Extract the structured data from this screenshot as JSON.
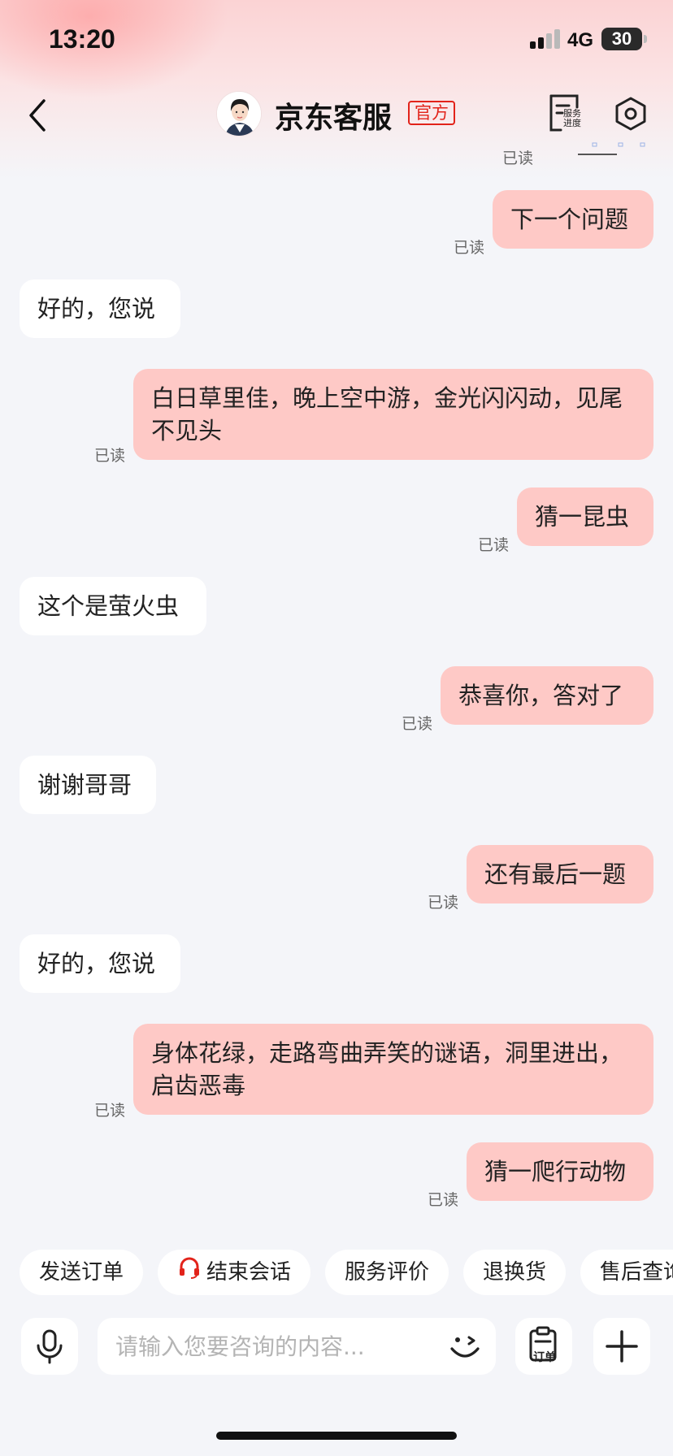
{
  "status_bar": {
    "time": "13:20",
    "network": "4G",
    "battery": "30"
  },
  "header": {
    "title": "京东客服",
    "official_badge": "官方",
    "service_progress_label": "服务进度"
  },
  "chat": {
    "top_read_status": "已读",
    "messages": [
      {
        "side": "out",
        "text": "下一个问题",
        "status": "已读"
      },
      {
        "side": "in",
        "text": "好的，您说"
      },
      {
        "side": "out",
        "text": "白日草里佳，晚上空中游，金光闪闪动，见尾不见头",
        "status": "已读"
      },
      {
        "side": "out",
        "text": "猜一昆虫",
        "status": "已读"
      },
      {
        "side": "in",
        "text": "这个是萤火虫"
      },
      {
        "side": "out",
        "text": "恭喜你，答对了",
        "status": "已读"
      },
      {
        "side": "in",
        "text": "谢谢哥哥"
      },
      {
        "side": "out",
        "text": "还有最后一题",
        "status": "已读"
      },
      {
        "side": "in",
        "text": "好的，您说"
      },
      {
        "side": "out",
        "text": "身体花绿，走路弯曲弄笑的谜语，洞里进出，启齿恶毒",
        "status": "已读"
      },
      {
        "side": "out",
        "text": "猜一爬行动物",
        "status": "已读"
      }
    ]
  },
  "quick_actions": [
    {
      "label": "发送订单"
    },
    {
      "label": "结束会话",
      "icon": "headset-icon"
    },
    {
      "label": "服务评价"
    },
    {
      "label": "退换货"
    },
    {
      "label": "售后查询"
    }
  ],
  "input": {
    "placeholder": "请输入您要咨询的内容...",
    "order_button_label": "订单"
  },
  "colors": {
    "accent_red": "#e2231a",
    "outgoing_bubble": "#fec9c6",
    "incoming_bubble": "#ffffff",
    "background": "#f4f5f9"
  }
}
